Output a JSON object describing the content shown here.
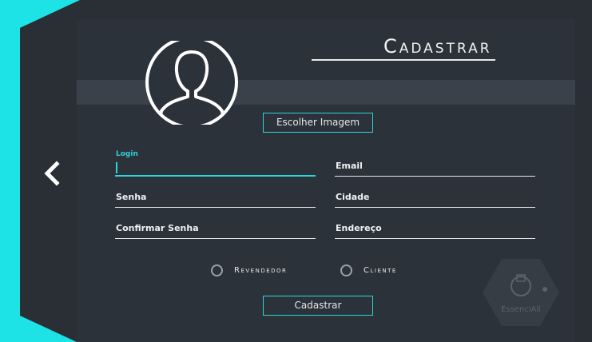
{
  "header": {
    "title": "Cadastrar"
  },
  "avatar": {
    "icon": "user-silhouette-icon"
  },
  "buttons": {
    "choose_image": "Escolher Imagem",
    "submit": "Cadastrar"
  },
  "back": {
    "icon": "chevron-left-icon"
  },
  "form": {
    "login": {
      "label": "Login",
      "value": ""
    },
    "senha": {
      "label": "Senha"
    },
    "confirmar": {
      "label": "Confirmar Senha"
    },
    "email": {
      "label": "Email"
    },
    "cidade": {
      "label": "Cidade"
    },
    "endereco": {
      "label": "Endereço"
    }
  },
  "radios": [
    {
      "label": "Revendedor",
      "checked": false
    },
    {
      "label": "Cliente",
      "checked": false
    }
  ],
  "watermark": {
    "text": "EssenciAll"
  },
  "colors": {
    "accent": "#2fd3d8",
    "background": "#2c323a",
    "band": "#3a414a"
  }
}
